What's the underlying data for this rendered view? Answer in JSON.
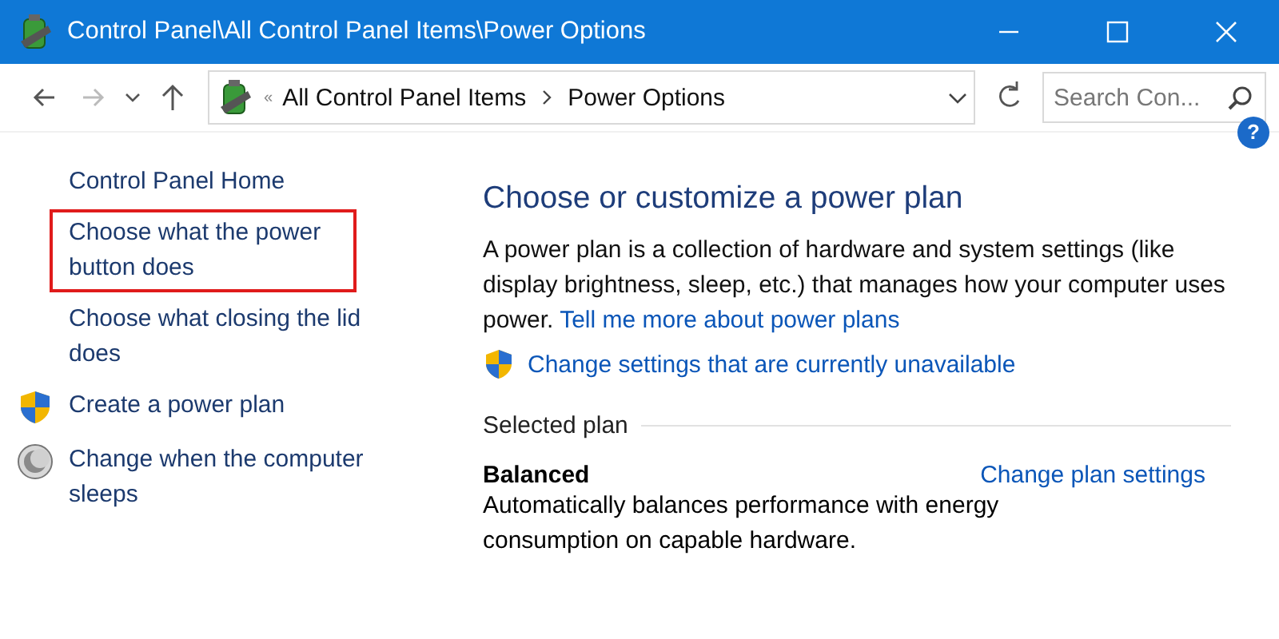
{
  "window": {
    "title": "Control Panel\\All Control Panel Items\\Power Options"
  },
  "address_bar": {
    "breadcrumbs": [
      "All Control Panel Items",
      "Power Options"
    ],
    "overflow": "«"
  },
  "search": {
    "placeholder": "Search Con..."
  },
  "sidebar": {
    "items": [
      {
        "label": "Control Panel Home",
        "kind": "plain",
        "highlighted": false
      },
      {
        "label": "Choose what the power button does",
        "kind": "plain",
        "highlighted": true
      },
      {
        "label": "Choose what closing the lid does",
        "kind": "plain",
        "highlighted": false
      },
      {
        "label": "Create a power plan",
        "kind": "shield",
        "highlighted": false
      },
      {
        "label": "Change when the computer sleeps",
        "kind": "moon",
        "highlighted": false
      }
    ]
  },
  "content": {
    "help": "?",
    "heading": "Choose or customize a power plan",
    "description": "A power plan is a collection of hardware and system settings (like display brightness, sleep, etc.) that manages how your computer uses power.",
    "description_link": "Tell me more about power plans",
    "admin_link": "Change settings that are currently unavailable",
    "section_title": "Selected plan",
    "plan": {
      "name": "Balanced",
      "settings_link": "Change plan settings",
      "description": "Automatically balances performance with energy consumption on capable hardware."
    }
  }
}
